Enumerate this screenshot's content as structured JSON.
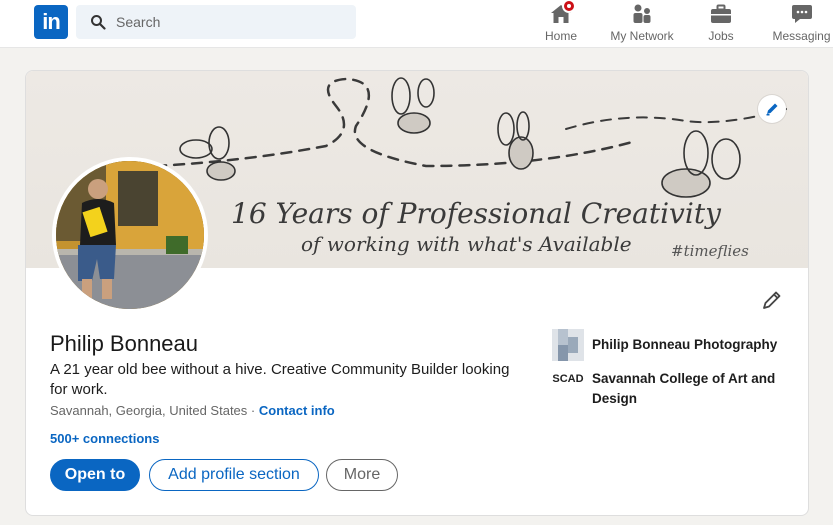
{
  "nav": {
    "search_placeholder": "Search",
    "items": [
      {
        "label": "Home",
        "icon": "home-icon"
      },
      {
        "label": "My Network",
        "icon": "network-icon"
      },
      {
        "label": "Jobs",
        "icon": "briefcase-icon"
      },
      {
        "label": "Messaging",
        "icon": "messaging-icon"
      }
    ]
  },
  "banner": {
    "line1": "16 Years of Professional Creativity",
    "line2": "of working with what's Available",
    "tag": "#timeflies"
  },
  "profile": {
    "name": "Philip Bonneau",
    "headline": "A 21 year old bee without a hive. Creative Community Builder looking for work.",
    "location": "Savannah, Georgia, United States",
    "separator": "·",
    "contact_label": "Contact info",
    "connections": "500+ connections"
  },
  "actions": {
    "open_to": "Open to",
    "add_section": "Add profile section",
    "more": "More"
  },
  "orgs": [
    {
      "name": "Philip Bonneau Photography",
      "logo": "photography-logo"
    },
    {
      "name": "Savannah College of Art and Design",
      "logo_text": "SCAD"
    }
  ],
  "colors": {
    "brand": "#0a66c2",
    "notification": "#cc1016",
    "background": "#f3f2ef"
  }
}
